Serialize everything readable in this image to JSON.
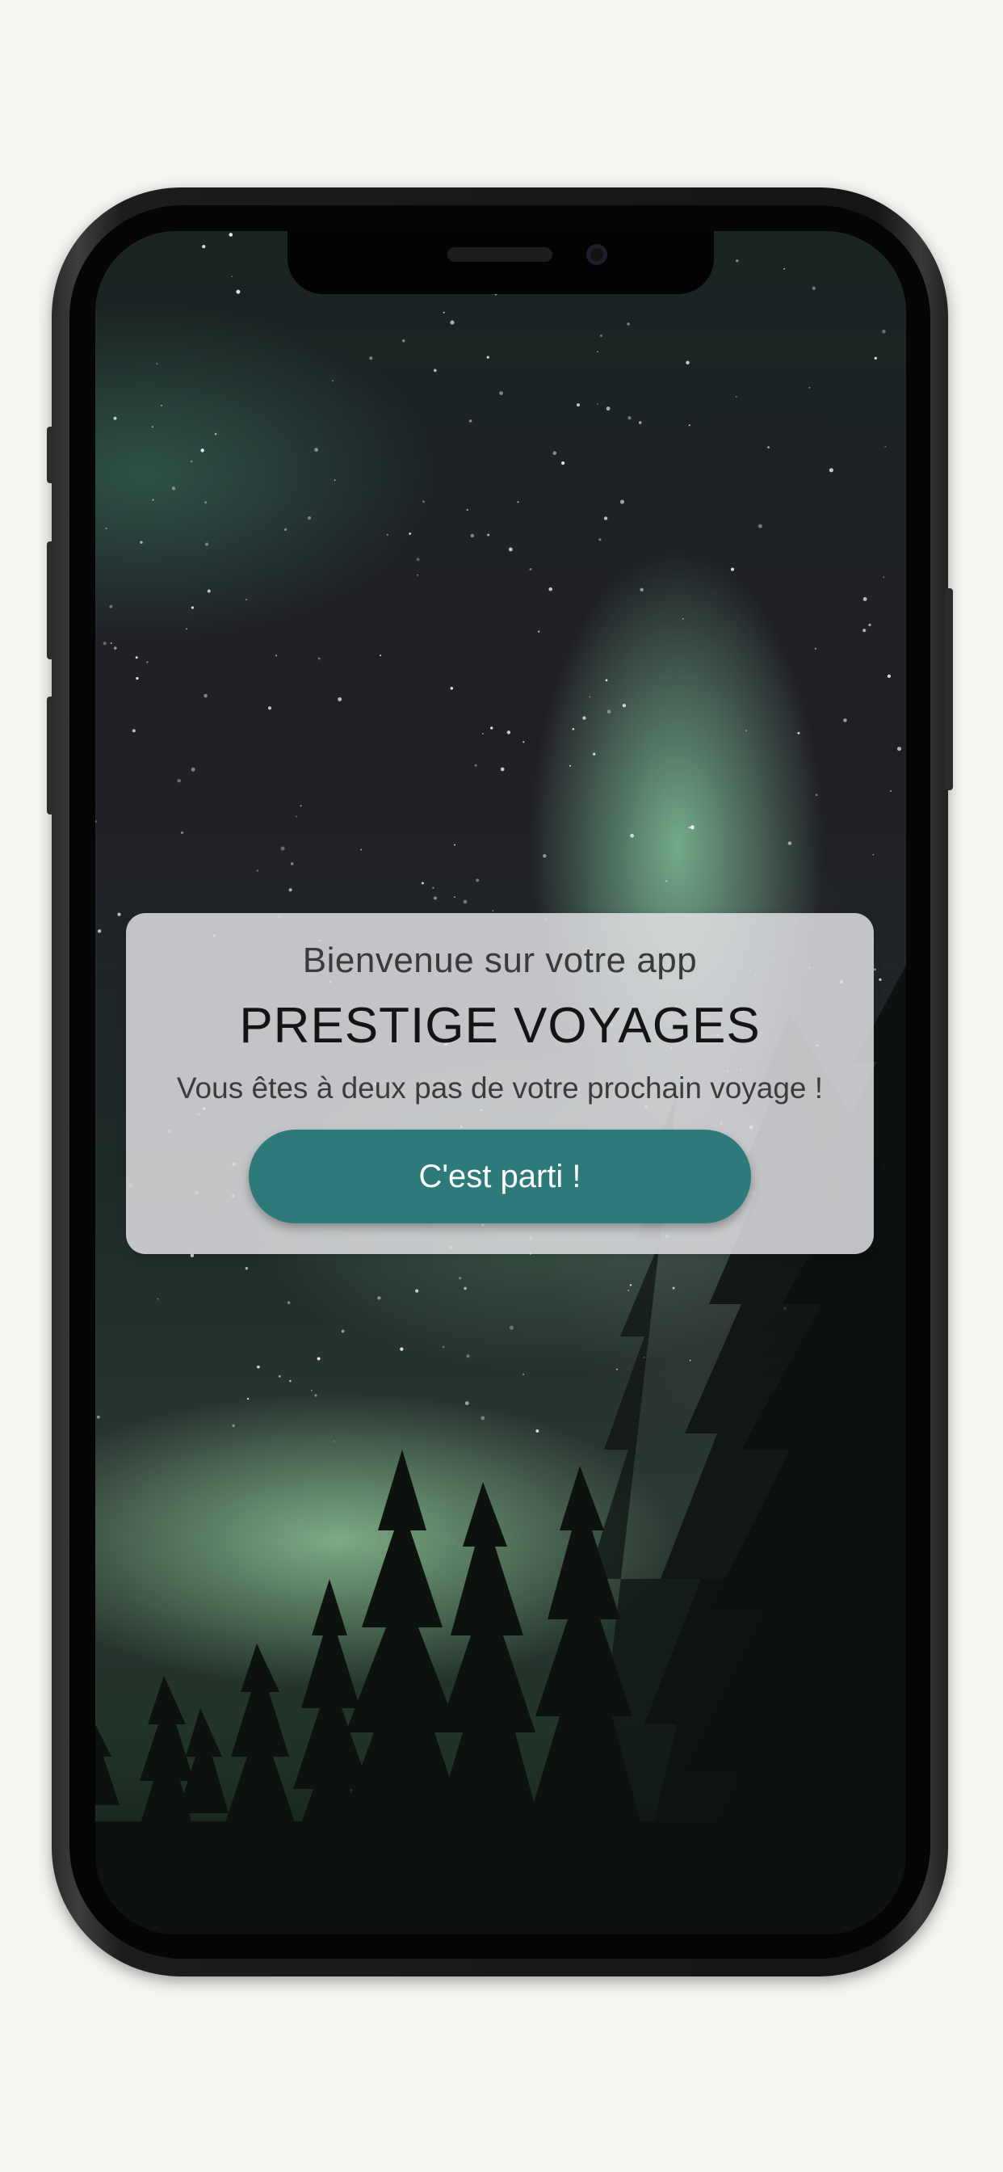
{
  "welcome_card": {
    "greeting": "Bienvenue sur votre app",
    "brand_name": "PRESTIGE VOYAGES",
    "tagline": "Vous êtes à deux pas de votre prochain voyage !",
    "cta_label": "C'est parti !"
  },
  "colors": {
    "page_background": "#f7f5f0",
    "card_background": "#dedee2",
    "button_background": "#2e7a7a",
    "button_text": "#ffffff",
    "aurora_green": "#8cd7aa"
  },
  "background": {
    "image_subject": "aurora borealis over pine forest at night"
  }
}
